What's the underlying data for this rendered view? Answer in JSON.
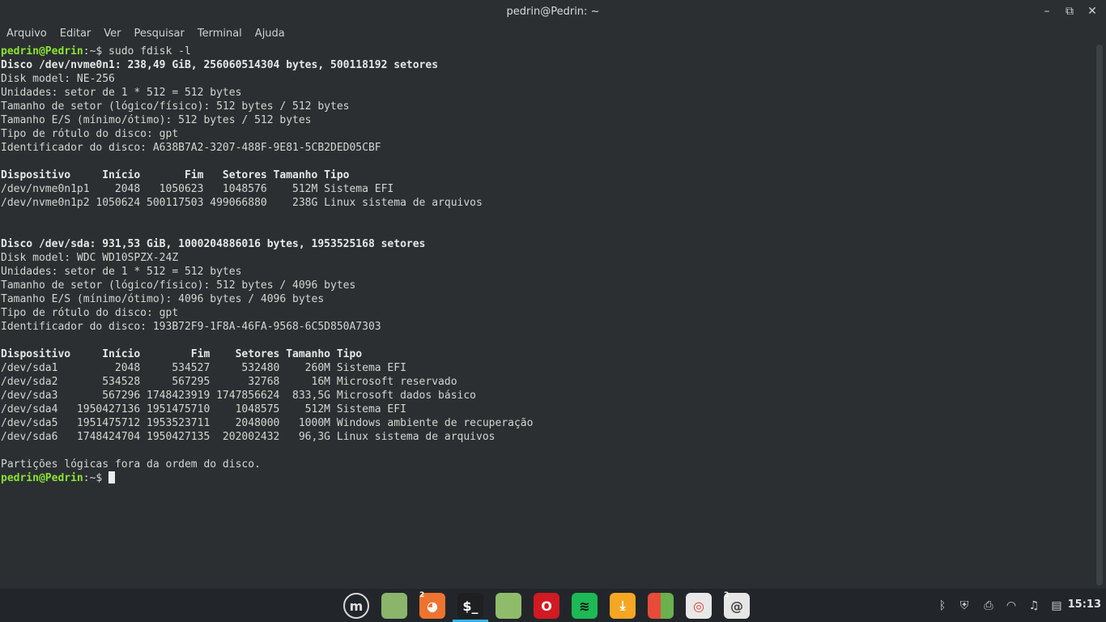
{
  "window": {
    "title": "pedrin@Pedrin: ~",
    "controls": {
      "minimize": "–",
      "maximize": "⧉",
      "close": "✕"
    }
  },
  "menu": [
    "Arquivo",
    "Editar",
    "Ver",
    "Pesquisar",
    "Terminal",
    "Ajuda"
  ],
  "terminal": {
    "prompt_user": "pedrin@Pedrin",
    "prompt_path": ":~$",
    "command": " sudo fdisk -l",
    "disk1": {
      "header": "Disco /dev/nvme0n1: 238,49 GiB, 256060514304 bytes, 500118192 setores",
      "info": [
        "Disk model: NE-256",
        "Unidades: setor de 1 * 512 = 512 bytes",
        "Tamanho de setor (lógico/físico): 512 bytes / 512 bytes",
        "Tamanho E/S (mínimo/ótimo): 512 bytes / 512 bytes",
        "Tipo de rótulo do disco: gpt",
        "Identificador do disco: A638B7A2-3207-488F-9E81-5CB2DED05CBF"
      ],
      "table_header": "Dispositivo     Início       Fim   Setores Tamanho Tipo",
      "rows": [
        "/dev/nvme0n1p1    2048   1050623   1048576    512M Sistema EFI",
        "/dev/nvme0n1p2 1050624 500117503 499066880    238G Linux sistema de arquivos"
      ]
    },
    "disk2": {
      "header": "Disco /dev/sda: 931,53 GiB, 1000204886016 bytes, 1953525168 setores",
      "info": [
        "Disk model: WDC WD10SPZX-24Z",
        "Unidades: setor de 1 * 512 = 512 bytes",
        "Tamanho de setor (lógico/físico): 512 bytes / 4096 bytes",
        "Tamanho E/S (mínimo/ótimo): 4096 bytes / 4096 bytes",
        "Tipo de rótulo do disco: gpt",
        "Identificador do disco: 193B72F9-1F8A-46FA-9568-6C5D850A7303"
      ],
      "table_header": "Dispositivo     Início        Fim    Setores Tamanho Tipo",
      "rows": [
        "/dev/sda1         2048     534527     532480    260M Sistema EFI",
        "/dev/sda2       534528     567295      32768     16M Microsoft reservado",
        "/dev/sda3       567296 1748423919 1747856624  833,5G Microsoft dados básico",
        "/dev/sda4   1950427136 1951475710    1048575    512M Sistema EFI",
        "/dev/sda5   1951475712 1953523711    2048000   1000M Windows ambiente de recuperação",
        "/dev/sda6   1748424704 1950427135  202002432   96,3G Linux sistema de arquivos"
      ]
    },
    "footer": "Partições lógicas fora da ordem do disco."
  },
  "taskbar": {
    "apps": [
      {
        "name": "mint-menu-icon",
        "glyph": "m",
        "bg": "#22262a",
        "fg": "#e0e0e0"
      },
      {
        "name": "desktop-icon",
        "glyph": "",
        "bg": "#8ab56b",
        "fg": "#fff"
      },
      {
        "name": "firefox-icon",
        "glyph": "◕",
        "bg": "#ef7330",
        "fg": "#fff",
        "badge": "2"
      },
      {
        "name": "terminal-icon",
        "glyph": "$_",
        "bg": "#1d1f21",
        "fg": "#ffffff",
        "active": true
      },
      {
        "name": "files-icon",
        "glyph": "",
        "bg": "#8fbc6a",
        "fg": "#fff"
      },
      {
        "name": "opera-icon",
        "glyph": "O",
        "bg": "#d11a22",
        "fg": "#fff"
      },
      {
        "name": "spotify-icon",
        "glyph": "≋",
        "bg": "#1db954",
        "fg": "#111"
      },
      {
        "name": "software-manager-icon",
        "glyph": "⤓",
        "bg": "#f5a623",
        "fg": "#fff"
      },
      {
        "name": "office-icon",
        "glyph": "",
        "bg": "#e84b3a",
        "fg": "#fff"
      },
      {
        "name": "chrome-icon",
        "glyph": "◎",
        "bg": "#e8e8e8",
        "fg": "#db4437"
      },
      {
        "name": "mail-icon",
        "glyph": "@",
        "bg": "#e6e6e6",
        "fg": "#444",
        "badge": "2"
      }
    ],
    "tray": [
      "bluetooth-icon",
      "shield-update-icon",
      "printer-icon",
      "wifi-icon",
      "sound-icon",
      "clipboard-icon"
    ],
    "clock": "15:13"
  }
}
